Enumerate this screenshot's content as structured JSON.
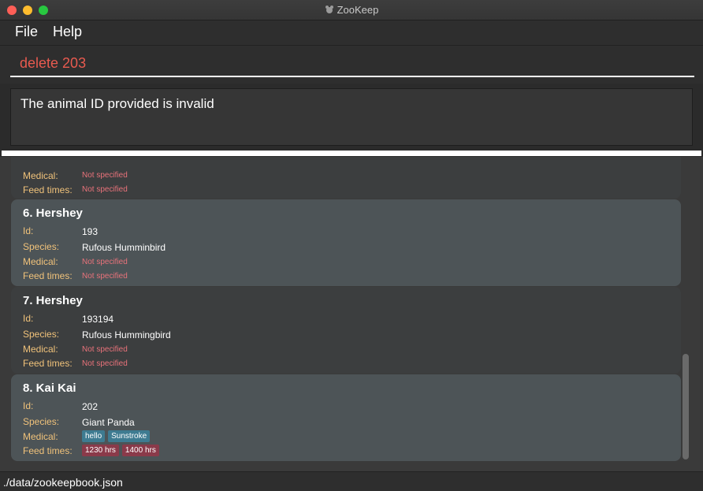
{
  "window": {
    "title": "ZooKeep"
  },
  "menu": {
    "file": "File",
    "help": "Help"
  },
  "command": {
    "value": "delete 203"
  },
  "result": {
    "message": "The animal ID provided is invalid"
  },
  "labels": {
    "id": "Id:",
    "species": "Species:",
    "medical": "Medical:",
    "feed": "Feed times:"
  },
  "not_specified": "Not specified",
  "animals": [
    {
      "title": "6.  Hershey",
      "id": "193",
      "species": "Rufous Humminbird",
      "medical": [],
      "feed": []
    },
    {
      "title": "7.  Hershey",
      "id": "193194",
      "species": "Rufous Hummingbird",
      "medical": [],
      "feed": []
    },
    {
      "title": "8.  Kai Kai",
      "id": "202",
      "species": "Giant Panda",
      "medical": [
        "hello",
        "Sunstroke"
      ],
      "feed": [
        "1230 hrs",
        "1400 hrs"
      ]
    }
  ],
  "statusbar": {
    "path": "./data/zookeepbook.json"
  }
}
